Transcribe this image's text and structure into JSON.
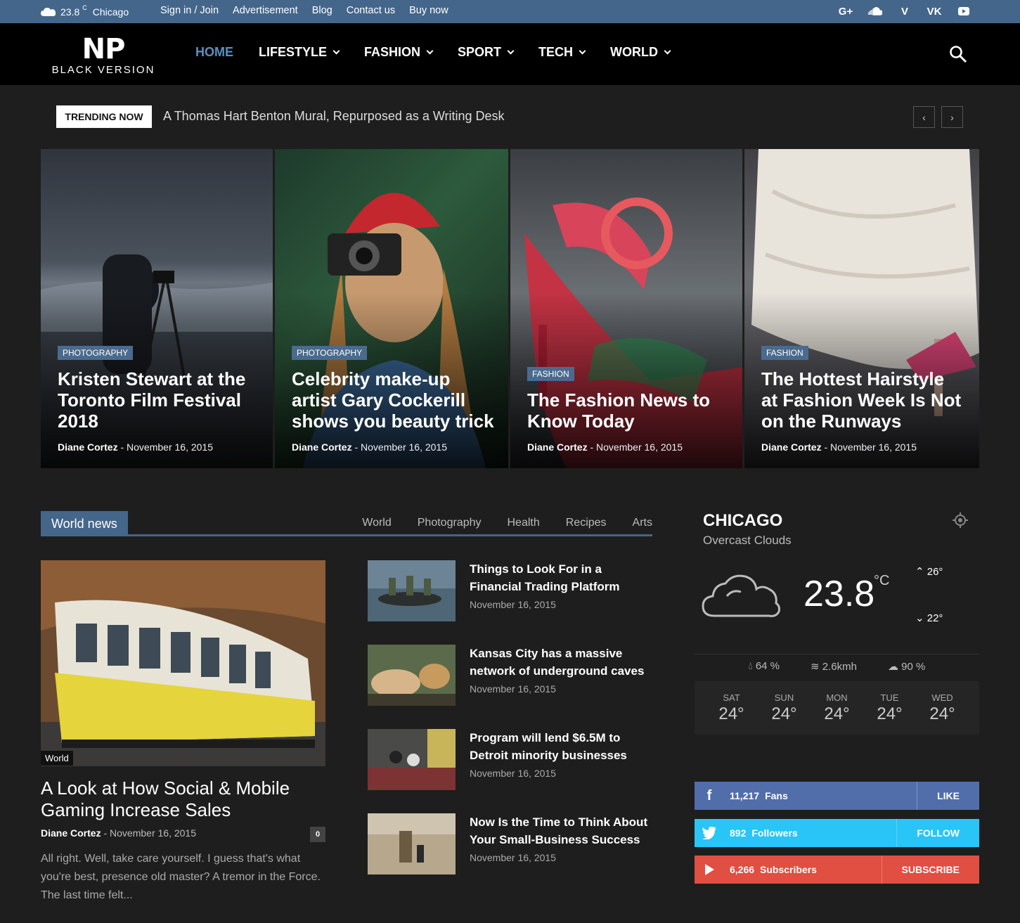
{
  "topbar": {
    "weather_icon": "cloud-icon",
    "temp": "23.8",
    "unit": "C",
    "city": "Chicago",
    "links": [
      "Sign in / Join",
      "Advertisement",
      "Blog",
      "Contact us",
      "Buy now"
    ],
    "social": [
      "G+",
      "soundcloud-icon",
      "V",
      "VK",
      "youtube-icon"
    ]
  },
  "header": {
    "logo_main": "NP",
    "logo_sub": "BLACK VERSION",
    "nav": [
      "HOME",
      "LIFESTYLE",
      "FASHION",
      "SPORT",
      "TECH",
      "WORLD"
    ],
    "accent": "#5c8fc2"
  },
  "trending": {
    "label": "TRENDING NOW",
    "title": "A Thomas Hart Benton Mural, Repurposed as a Writing Desk",
    "prev": "‹",
    "next": "›"
  },
  "featured": [
    {
      "category": "PHOTOGRAPHY",
      "title": "Kristen Stewart at the Toronto Film Festival 2018",
      "author": "Diane Cortez",
      "date": "November 16, 2015"
    },
    {
      "category": "PHOTOGRAPHY",
      "title": "Celebrity make-up artist Gary Cockerill shows you beauty trick",
      "author": "Diane Cortez",
      "date": "November 16, 2015"
    },
    {
      "category": "FASHION",
      "title": "The Fashion News to Know Today",
      "author": "Diane Cortez",
      "date": "November 16, 2015"
    },
    {
      "category": "FASHION",
      "title": "The Hottest Hairstyle at Fashion Week Is Not on the Runways",
      "author": "Diane Cortez",
      "date": "November 16, 2015"
    }
  ],
  "world_news": {
    "label": "World news",
    "tabs": [
      "World",
      "Photography",
      "Health",
      "Recipes",
      "Arts"
    ],
    "main": {
      "category": "World",
      "title": "A Look at How Social & Mobile Gaming Increase Sales",
      "author": "Diane Cortez",
      "date": "November 16, 2015",
      "comments": "0",
      "excerpt": "All right. Well, take care yourself. I guess that's what you're best, presence old master? A tremor in the Force. The last time felt..."
    },
    "side": [
      {
        "title": "Things to Look For in a Financial Trading Platform",
        "date": "November 16, 2015"
      },
      {
        "title": "Kansas City has a massive network of underground caves",
        "date": "November 16, 2015"
      },
      {
        "title": "Program will lend $6.5M to Detroit minority businesses",
        "date": "November 16, 2015"
      },
      {
        "title": "Now Is the Time to Think About Your Small-Business Success",
        "date": "November 16, 2015"
      }
    ]
  },
  "weather": {
    "city": "CHICAGO",
    "description": "Overcast Clouds",
    "temp": "23.8",
    "unit": "°C",
    "high": "26°",
    "low": "22°",
    "humidity": "64 %",
    "wind": "2.6kmh",
    "clouds": "90 %",
    "forecast": [
      {
        "day": "SAT",
        "temp": "24°"
      },
      {
        "day": "SUN",
        "temp": "24°"
      },
      {
        "day": "MON",
        "temp": "24°"
      },
      {
        "day": "TUE",
        "temp": "24°"
      },
      {
        "day": "WED",
        "temp": "24°"
      }
    ]
  },
  "social_counters": [
    {
      "network": "facebook",
      "icon": "f",
      "count": "11,217",
      "label": "Fans",
      "action": "LIKE",
      "color": "#516eab"
    },
    {
      "network": "twitter",
      "icon": "twitter-icon",
      "count": "892",
      "label": "Followers",
      "action": "FOLLOW",
      "color": "#29c5f6"
    },
    {
      "network": "youtube",
      "icon": "youtube-icon",
      "count": "6,266",
      "label": "Subscribers",
      "action": "SUBSCRIBE",
      "color": "#e14e42"
    }
  ]
}
